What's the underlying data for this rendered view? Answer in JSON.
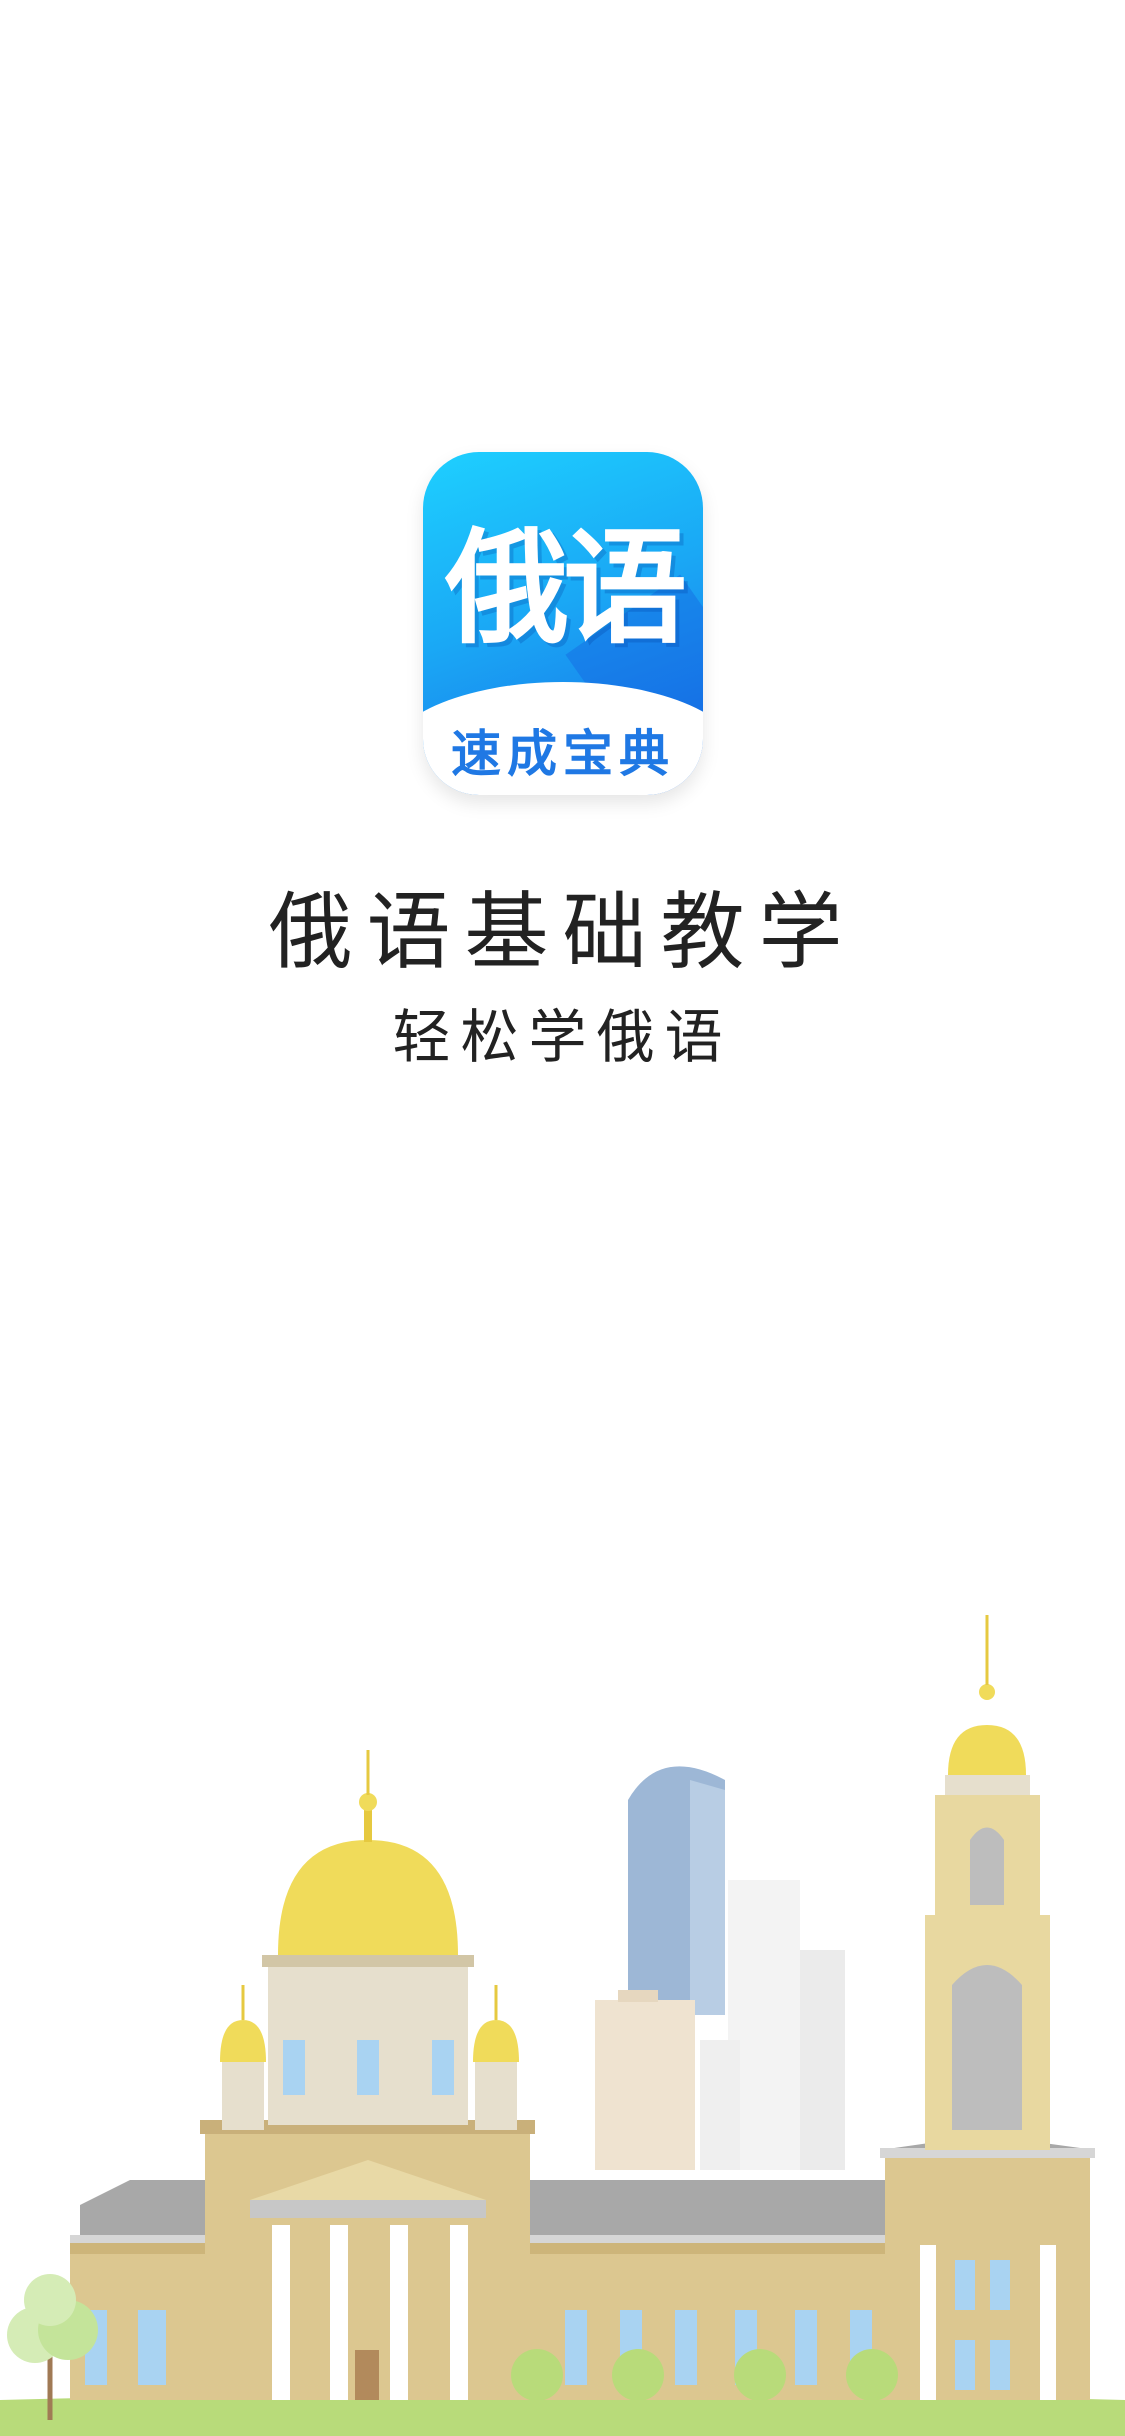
{
  "icon": {
    "title": "俄语",
    "subtitle": "速成宝典"
  },
  "title": "俄语基础教学",
  "subtitle": "轻松学俄语",
  "illustration": {
    "name": "city-skyline-illustration"
  },
  "colors": {
    "icon_gradient_top": "#1ed0ff",
    "icon_gradient_bottom": "#1769e6",
    "icon_subtitle": "#1f78e4",
    "building": "#dcc790",
    "dome": "#f0db5a",
    "roof": "#a8a8a8",
    "tower_blue": "#9db7d6",
    "ground": "#b8db7a"
  }
}
